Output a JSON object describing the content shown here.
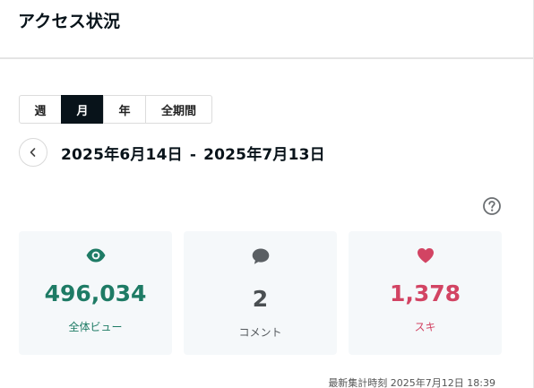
{
  "header": {
    "title": "アクセス状況"
  },
  "period_tabs": [
    {
      "label": "週",
      "active": false
    },
    {
      "label": "月",
      "active": true
    },
    {
      "label": "年",
      "active": false
    },
    {
      "label": "全期間",
      "active": false
    }
  ],
  "date_range": {
    "start": "2025年6月14日",
    "separator": "-",
    "end": "2025年7月13日"
  },
  "stats": {
    "views": {
      "value": "496,034",
      "label": "全体ビュー",
      "icon": "eye-icon",
      "color": "#1e7b65"
    },
    "comments": {
      "value": "2",
      "label": "コメント",
      "icon": "speech-bubble-icon",
      "color": "#4a4f52"
    },
    "likes": {
      "value": "1,378",
      "label": "スキ",
      "icon": "heart-icon",
      "color": "#d24463"
    }
  },
  "footer": {
    "last_updated": "最新集計時刻 2025年7月12日 18:39"
  }
}
